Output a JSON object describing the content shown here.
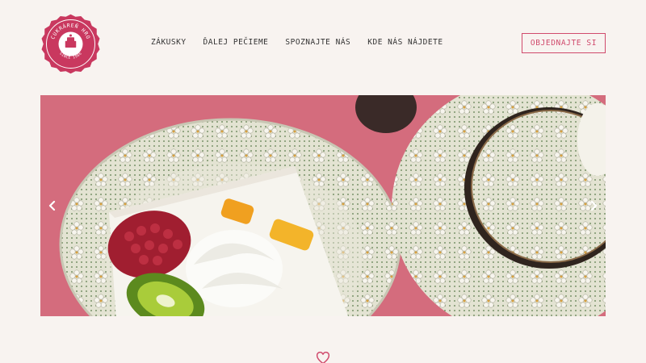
{
  "brand": {
    "arc_text": "CUKRÁREŇ HRO",
    "since_text": "SINCE 1986",
    "colors": {
      "ring": "#c9385f",
      "inner": "#ffffff",
      "accent": "#c9385f"
    }
  },
  "nav": {
    "items": [
      {
        "label": "ZÁKUSKY"
      },
      {
        "label": "ĎALEJ PEČIEME"
      },
      {
        "label": "SPOZNAJTE NÁS"
      },
      {
        "label": "KDE NÁS NÁJDETE"
      }
    ]
  },
  "cta": {
    "label": "OBJEDNAJTE SI"
  },
  "hero": {
    "prev_icon": "chevron-left-icon",
    "next_icon": "chevron-right-icon",
    "image_subject": "cake slice with raspberry, kiwi and mango on a floral plate next to a teapot"
  },
  "footer_icon": "heart-icon",
  "colors": {
    "background": "#f8f3f0",
    "accent": "#d04a6c",
    "nav_text": "#333333"
  }
}
